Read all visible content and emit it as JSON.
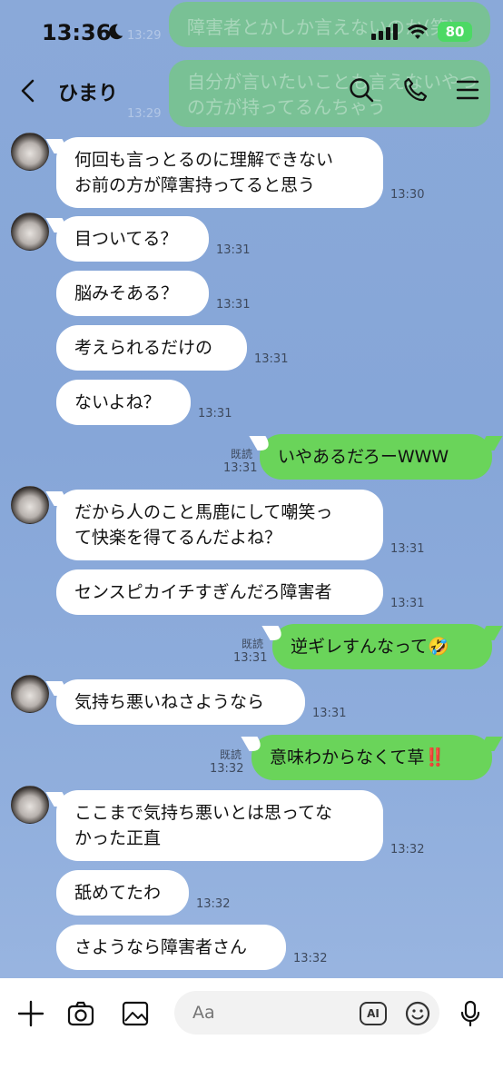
{
  "status": {
    "time": "13:36",
    "battery": "80"
  },
  "header": {
    "title": "ひまり"
  },
  "ghost_messages": [
    {
      "text": "障害者とかしか言えないのか(笑)"
    },
    {
      "text": "自分が言いたいことも言えないやつの方が持ってるんちゃう"
    }
  ],
  "ghost_times": [
    "13:29",
    "13:29"
  ],
  "messages": [
    {
      "side": "other",
      "lines": [
        "何回も言っとるのに理解できない",
        "お前の方が障害持ってると思う"
      ],
      "time": "13:30"
    },
    {
      "side": "other",
      "lines": [
        "目ついてる？"
      ],
      "time": "13:31"
    },
    {
      "side": "other",
      "lines": [
        "脳みそある？"
      ],
      "time": "13:31"
    },
    {
      "side": "other",
      "lines": [
        "考えられるだけの"
      ],
      "time": "13:31"
    },
    {
      "side": "other",
      "lines": [
        "ないよね？"
      ],
      "time": "13:31"
    },
    {
      "side": "me",
      "lines": [
        "いやあるだろーWWW"
      ],
      "time": "13:31",
      "read": "既読"
    },
    {
      "side": "other",
      "lines": [
        "だから人のこと馬鹿にして嘲笑っ",
        "て快楽を得てるんだよね？"
      ],
      "time": "13:31"
    },
    {
      "side": "other",
      "lines": [
        "センスピカイチすぎんだろ障害者"
      ],
      "time": "13:31"
    },
    {
      "side": "me",
      "lines": [
        "逆ギレすんなって🤣"
      ],
      "time": "13:31",
      "read": "既読"
    },
    {
      "side": "other",
      "lines": [
        "気持ち悪いねさようなら"
      ],
      "time": "13:31"
    },
    {
      "side": "me",
      "lines": [
        "意味わからなくて草‼️"
      ],
      "time": "13:32",
      "read": "既読"
    },
    {
      "side": "other",
      "lines": [
        "ここまで気持ち悪いとは思ってな",
        "かった正直"
      ],
      "time": "13:32"
    },
    {
      "side": "other",
      "lines": [
        "舐めてたわ"
      ],
      "time": "13:32"
    },
    {
      "side": "other",
      "lines": [
        "さようなら障害者さん"
      ],
      "time": "13:32"
    }
  ],
  "input": {
    "placeholder": "Aa",
    "ai_label": "AI"
  },
  "icons": {
    "back": "chevron-left-icon",
    "search": "search-icon",
    "call": "phone-icon",
    "menu": "menu-icon",
    "add": "plus-icon",
    "camera": "camera-icon",
    "image": "image-icon",
    "ai": "ai-icon",
    "emoji": "emoji-icon",
    "mic": "mic-icon"
  },
  "colors": {
    "background": "#8aa9d9",
    "my_bubble": "#6ad45a",
    "other_bubble": "#ffffff"
  }
}
